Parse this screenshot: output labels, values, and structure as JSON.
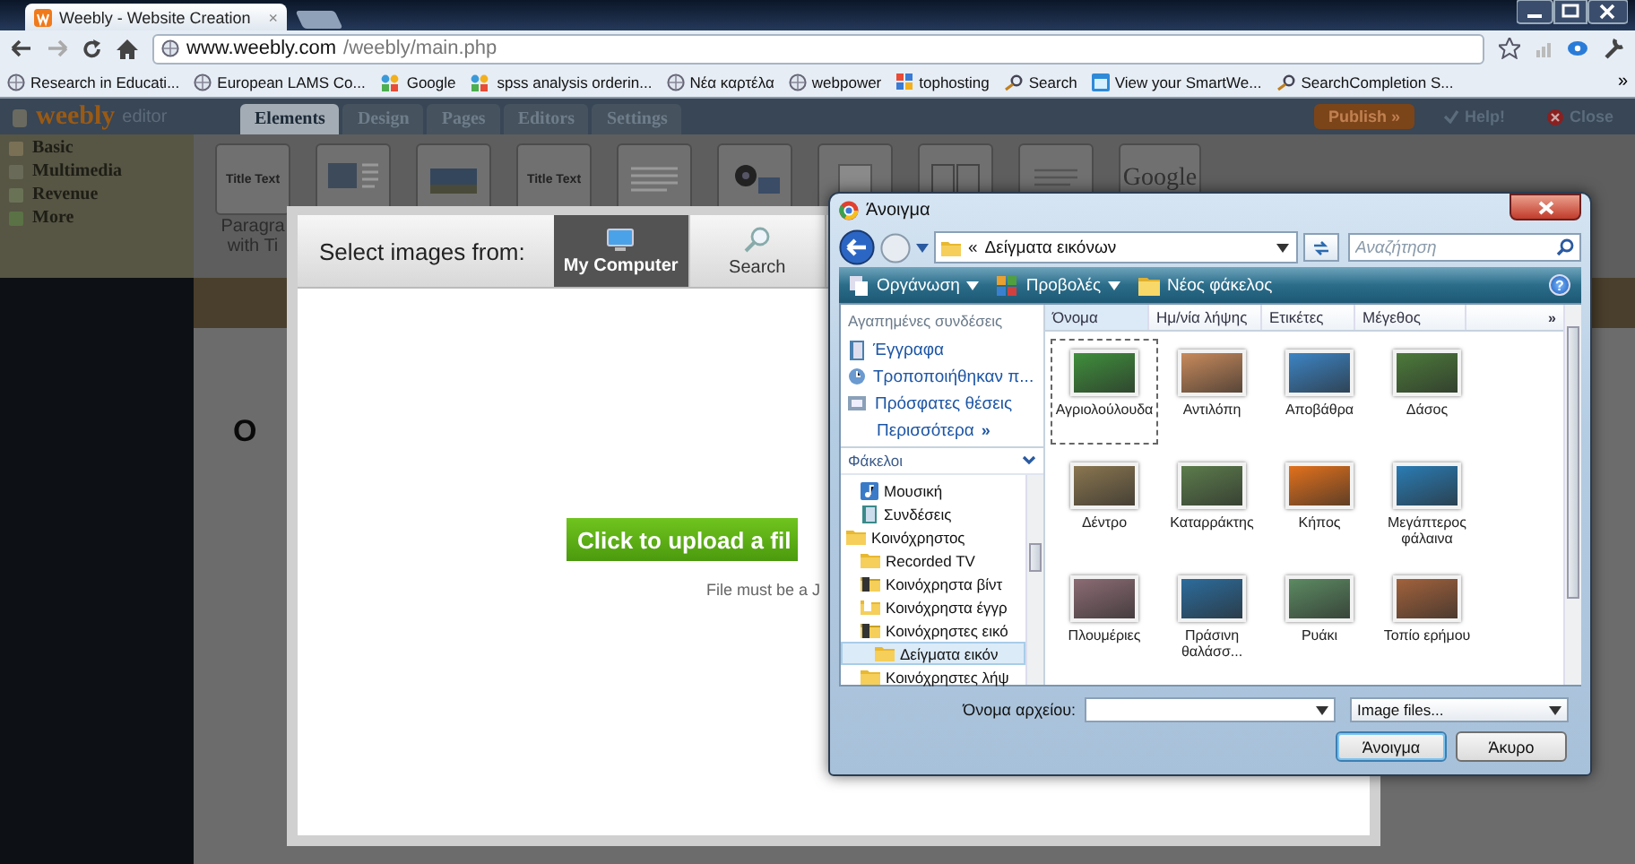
{
  "browser": {
    "tabs": [
      {
        "title": "Weebly - Website Creation",
        "close": "×",
        "selected": true
      }
    ],
    "address": {
      "host": "www.weebly.com",
      "path": "/weebly/main.php"
    },
    "bookmarks": [
      {
        "label": "Research in Educati...",
        "kind": "globe"
      },
      {
        "label": "European LAMS Co...",
        "kind": "globe"
      },
      {
        "label": "Google",
        "kind": "people"
      },
      {
        "label": "spss analysis orderin...",
        "kind": "people"
      },
      {
        "label": "Νέα καρτέλα",
        "kind": "globe"
      },
      {
        "label": "webpower",
        "kind": "globe"
      },
      {
        "label": "tophosting",
        "kind": "grid"
      },
      {
        "label": "Search",
        "kind": "search"
      },
      {
        "label": "View your SmartWe...",
        "kind": "calendar"
      },
      {
        "label": "SearchCompletion S...",
        "kind": "search"
      }
    ],
    "bookmarks_more": "»"
  },
  "editor": {
    "logo": "weebly",
    "logo_sub": "editor",
    "tabs": [
      {
        "label": "Elements",
        "selected": true
      },
      {
        "label": "Design",
        "selected": false
      },
      {
        "label": "Pages",
        "selected": false
      },
      {
        "label": "Editors",
        "selected": false
      },
      {
        "label": "Settings",
        "selected": false
      }
    ],
    "actions": [
      {
        "label": "Publish »",
        "kind": "publish"
      },
      {
        "label": "Help!",
        "kind": "help"
      },
      {
        "label": "Close",
        "kind": "close"
      }
    ],
    "categories": [
      "Basic",
      "Multimedia",
      "Revenue",
      "More"
    ],
    "elements": [
      {
        "kind": "text",
        "caption": "Title Text"
      },
      {
        "kind": "image-text"
      },
      {
        "kind": "image"
      },
      {
        "kind": "title",
        "caption": "Title Text"
      },
      {
        "kind": "text-block"
      },
      {
        "kind": "media"
      },
      {
        "kind": "blank"
      },
      {
        "kind": "columns"
      },
      {
        "kind": "code"
      },
      {
        "kind": "logo",
        "caption": "Google"
      }
    ],
    "element_label": [
      "Paragra",
      "with Ti"
    ],
    "page_title": "O"
  },
  "upload": {
    "label": "Select images from:",
    "sources": [
      {
        "label": "My Computer",
        "kind": "computer",
        "selected": true
      },
      {
        "label": "Search",
        "kind": "search",
        "selected": false
      }
    ],
    "upload_button": "Click to upload a fil",
    "note": "File must be a J"
  },
  "dialog": {
    "title": "Άνοιγμα",
    "breadcrumb_prefix": "«",
    "breadcrumb": "Δείγματα εικόνων",
    "search": {
      "placeholder": "Αναζήτηση"
    },
    "toolbar": [
      {
        "label": "Οργάνωση",
        "kind": "organize",
        "dropdown": true
      },
      {
        "label": "Προβολές",
        "kind": "views",
        "dropdown": true
      },
      {
        "label": "Νέος φάκελος",
        "kind": "new-folder",
        "dropdown": false
      }
    ],
    "help": "?",
    "favorites_title": "Αγαπημένες συνδέσεις",
    "favorites": [
      {
        "label": "Έγγραφα",
        "kind": "documents"
      },
      {
        "label": "Τροποποιήθηκαν π...",
        "kind": "recent-changes"
      },
      {
        "label": "Πρόσφατες θέσεις",
        "kind": "places"
      }
    ],
    "favorites_more": "Περισσότερα",
    "favorites_more_mark": "»",
    "folders_title": "Φάκελοι",
    "tree": [
      {
        "children": [
          {
            "label": "Μουσική",
            "kind": "music",
            "selected": false
          },
          {
            "label": "Συνδέσεις",
            "kind": "links",
            "selected": false
          }
        ]
      },
      {
        "label": "Κοινόχρηστος",
        "kind": "folder",
        "selected": false,
        "children": [
          {
            "label": "Recorded TV",
            "kind": "folder",
            "selected": false
          },
          {
            "label": "Κοινόχρηστα βίντ",
            "kind": "video-folder",
            "selected": false
          },
          {
            "label": "Κοινόχρηστα έγγρ",
            "kind": "doc-folder",
            "selected": false
          },
          {
            "label": "Κοινόχρηστες εικό",
            "kind": "video-folder",
            "selected": false,
            "children": [
              {
                "label": "Δείγματα εικόν",
                "kind": "folder",
                "selected": true
              }
            ]
          },
          {
            "label": "Κοινόχρηστες λήψ",
            "kind": "folder",
            "selected": false
          }
        ]
      }
    ],
    "columns": [
      {
        "label": "Όνομα",
        "selected": true
      },
      {
        "label": "Ημ/νία λήψης",
        "selected": false
      },
      {
        "label": "Ετικέτες",
        "selected": false
      },
      {
        "label": "Μέγεθος",
        "selected": false
      }
    ],
    "columns_more": "»",
    "files": [
      {
        "name": "Αγριολούλουδα",
        "selected": true
      },
      {
        "name": "Αντιλόπη",
        "selected": false
      },
      {
        "name": "Αποβάθρα",
        "selected": false
      },
      {
        "name": "Δάσος",
        "selected": false
      },
      {
        "name": "Δέντρο",
        "selected": false
      },
      {
        "name": "Καταρράκτης",
        "selected": false
      },
      {
        "name": "Κήπος",
        "selected": false
      },
      {
        "name": "Μεγάπτερος φάλαινα",
        "selected": false
      },
      {
        "name": "Πλουμέριες",
        "selected": false
      },
      {
        "name": "Πράσινη θαλάσσ...",
        "selected": false
      },
      {
        "name": "Ρυάκι",
        "selected": false
      },
      {
        "name": "Τοπίο ερήμου",
        "selected": false
      }
    ],
    "file_name_label": "Όνομα αρχείου:",
    "file_type": "Image files...",
    "buttons": [
      {
        "label": "Άνοιγμα",
        "kind": "default"
      },
      {
        "label": "Άκυρο",
        "kind": "normal"
      }
    ]
  }
}
